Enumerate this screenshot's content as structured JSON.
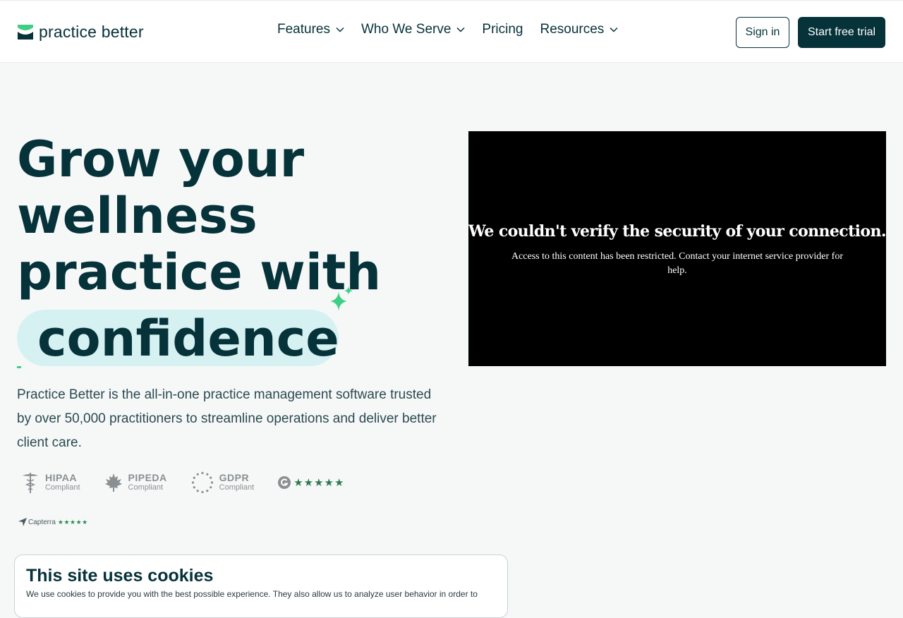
{
  "header": {
    "logo_text": "practice better",
    "nav": [
      {
        "label": "Features",
        "has_dropdown": true
      },
      {
        "label": "Who We Serve",
        "has_dropdown": true
      },
      {
        "label": "Pricing",
        "has_dropdown": false
      },
      {
        "label": "Resources",
        "has_dropdown": true
      }
    ],
    "signin_label": "Sign in",
    "trial_label": "Start free trial"
  },
  "hero": {
    "title_lines": [
      "Grow your",
      "wellness",
      "practice with"
    ],
    "highlight": "confidence",
    "description": "Practice Better is the all-in-one practice management software trusted by over 50,000 practitioners to streamline operations and deliver better client care."
  },
  "badges": [
    {
      "name": "HIPAA",
      "sub": "Compliant",
      "icon": "caduceus-icon"
    },
    {
      "name": "PIPEDA",
      "sub": "Compliant",
      "icon": "maple-leaf-icon"
    },
    {
      "name": "GDPR",
      "sub": "Compliant",
      "icon": "eu-stars-icon"
    }
  ],
  "g2": {
    "stars": "★★★★★",
    "rating": 4.5
  },
  "capterra": {
    "label": "Capterra",
    "stars": "★★★★★"
  },
  "video": {
    "title": "We couldn't verify the security of your connection.",
    "body": "Access to this content has been restricted. Contact your internet service provider for help."
  },
  "cookie": {
    "title": "This site uses cookies",
    "text": "We use cookies to provide you with the best possible experience. They also allow us to analyze user behavior in order to"
  },
  "colors": {
    "primary": "#06323a",
    "accent_green": "#3fcf84",
    "highlight_bg": "#d6f1f2",
    "page_bg": "#f6f8f8"
  }
}
